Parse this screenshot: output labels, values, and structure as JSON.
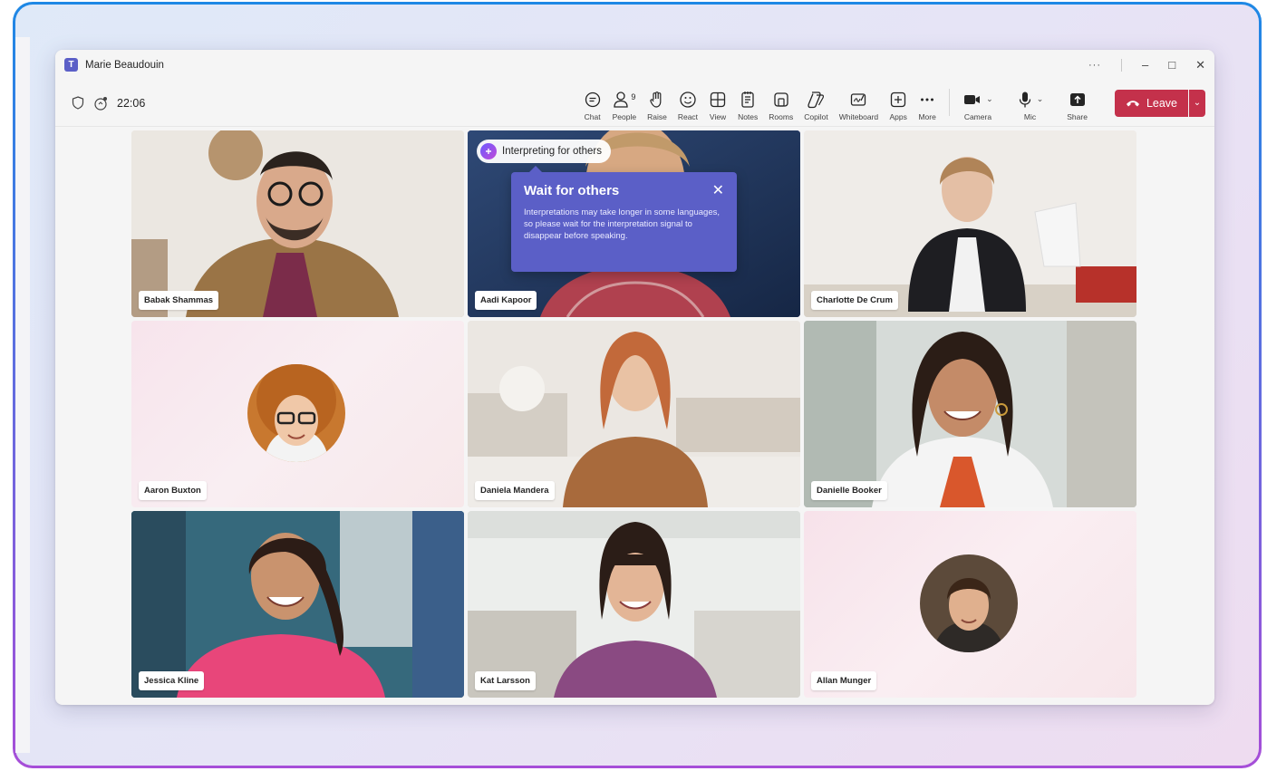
{
  "window": {
    "title": "Marie Beaudouin",
    "controls": {
      "more": "···",
      "minimize": "–",
      "maximize": "□",
      "close": "✕"
    }
  },
  "meeting": {
    "elapsed": "22:06"
  },
  "toolbar": {
    "chat": "Chat",
    "people": "People",
    "people_count": "9",
    "raise": "Raise",
    "react": "React",
    "view": "View",
    "notes": "Notes",
    "rooms": "Rooms",
    "copilot": "Copilot",
    "whiteboard": "Whiteboard",
    "apps": "Apps",
    "more": "More",
    "camera": "Camera",
    "mic": "Mic",
    "share": "Share",
    "leave": "Leave"
  },
  "interpretation": {
    "pill": "Interpreting for others",
    "callout_title": "Wait for others",
    "callout_body": "Interpretations may take longer in some languages, so please wait for the interpretation signal to disappear before speaking."
  },
  "participants": [
    {
      "name": "Babak Shammas"
    },
    {
      "name": "Aadi Kapoor"
    },
    {
      "name": "Charlotte De Crum"
    },
    {
      "name": "Aaron Buxton"
    },
    {
      "name": "Daniela Mandera"
    },
    {
      "name": "Danielle Booker"
    },
    {
      "name": "Jessica Kline"
    },
    {
      "name": "Kat Larsson"
    },
    {
      "name": "Allan Munger"
    }
  ],
  "colors": {
    "accent": "#5b5fc7",
    "leave": "#c4314b",
    "frame_top": "#1e88e5",
    "frame_bottom": "#a64ed8"
  }
}
